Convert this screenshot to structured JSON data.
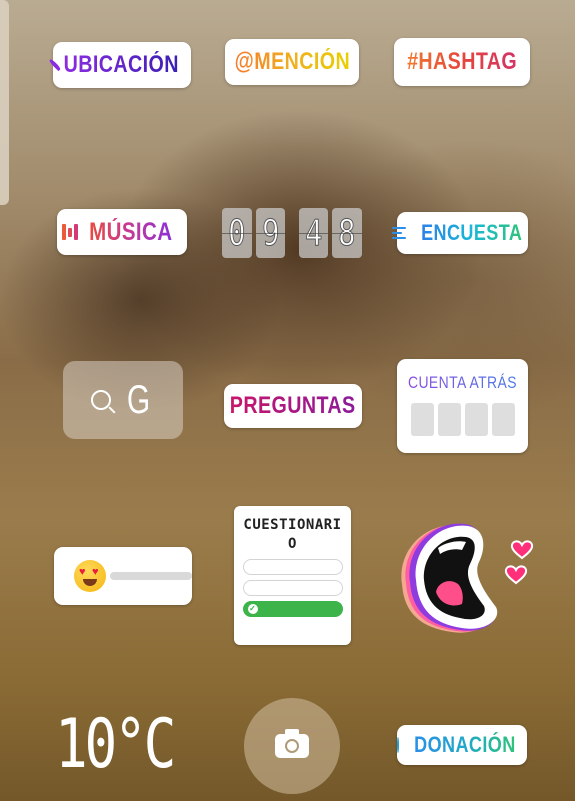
{
  "stickers": {
    "location": {
      "label": "UBICACIÓN",
      "icon": "location-pin-icon"
    },
    "mention": {
      "label": "@MENCIÓN"
    },
    "hashtag": {
      "label": "#HASHTAG"
    },
    "music": {
      "label": "MÚSICA",
      "icon": "music-bars-icon"
    },
    "clock": {
      "digits": [
        "0",
        "9",
        "4",
        "8"
      ]
    },
    "poll": {
      "label": "ENCUESTA",
      "icon": "poll-lines-icon"
    },
    "gif_search": {
      "value": "G",
      "icon": "search-icon"
    },
    "questions": {
      "label": "PREGUNTAS"
    },
    "countdown": {
      "label": "CUENTA ATRÁS"
    },
    "emoji_slider": {
      "emoji": "heart-eyes-emoji"
    },
    "quiz": {
      "label_line1": "CUESTIONARI",
      "label_line2": "O"
    },
    "mouth": {
      "icon": "open-mouth-sticker-icon"
    },
    "temperature": {
      "value": "10°C"
    },
    "donation": {
      "label": "DONACIÓN",
      "icon": "heart-circle-icon"
    }
  },
  "camera": {
    "icon": "camera-icon"
  },
  "colors": {
    "quiz_correct": "#3cb44a",
    "location": "#8a2be2",
    "music_accent": "#e84b3c"
  }
}
